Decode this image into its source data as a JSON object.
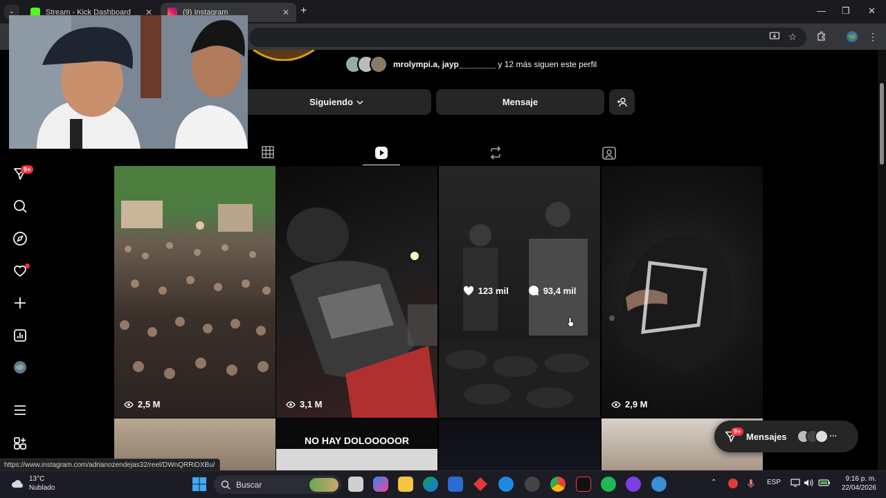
{
  "browser": {
    "tabs": [
      {
        "label": "Stream - Kick Dashboard",
        "active": false
      },
      {
        "label": "(9) Instagram",
        "active": true
      }
    ],
    "new_tab": "+",
    "window_controls": [
      "—",
      "❐",
      "✕"
    ]
  },
  "profile": {
    "followers_names": "mrolympi.a, jayp________",
    "followers_suffix": " y 12 más siguen este perfil",
    "buttons": {
      "following": "Siguiendo",
      "message": "Mensaje"
    }
  },
  "sidebar": {
    "messages_badge": "9+"
  },
  "grid": {
    "tiles": [
      {
        "views": "2,5 M"
      },
      {
        "views": "3,1 M"
      },
      {
        "likes": "123 mil",
        "comments": "93,4 mil"
      },
      {
        "views": "2,9 M"
      }
    ],
    "row2_text": "NO HAY DOLOOOOOR"
  },
  "messages_pill": {
    "label": "Mensajes",
    "badge": "9+",
    "more": "···"
  },
  "status_url": "https://www.instagram.com/adrianozendejas32/reel/DWnQRRiDXBu/",
  "taskbar": {
    "weather_temp": "13°C",
    "weather_desc": "Nublado",
    "search_placeholder": "Buscar",
    "language": "ESP",
    "time": "9:16 p. m.",
    "date": "22/04/2026"
  },
  "colors": {
    "accent_red": "#ff3040",
    "button_bg": "#262626"
  }
}
